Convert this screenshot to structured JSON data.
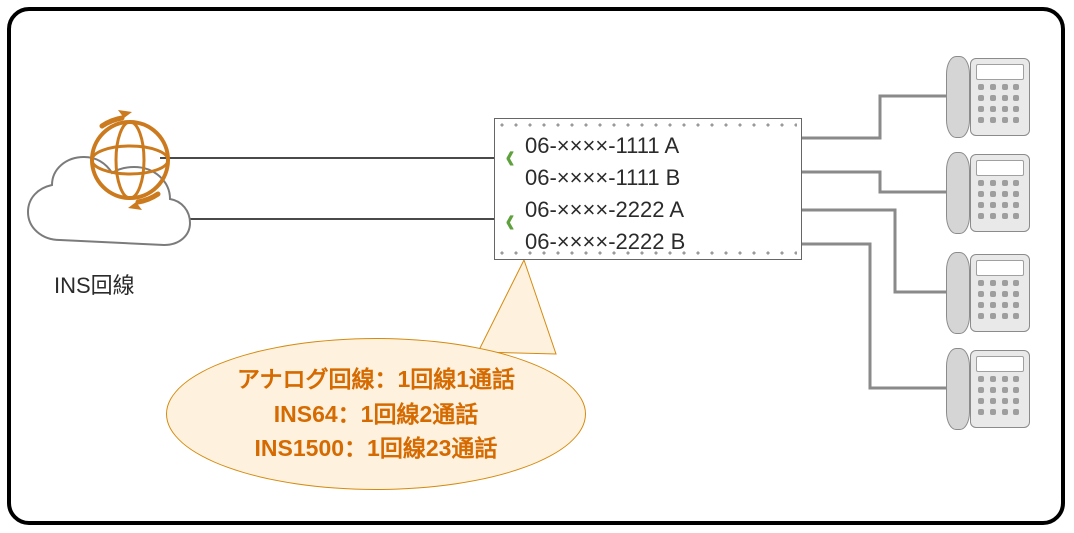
{
  "diagram_type": "network-telecom",
  "frame": {
    "radius": 22
  },
  "cloud": {
    "label": "INS回線"
  },
  "pbx": {
    "channels": [
      {
        "text": "06-××××-1111 A",
        "arrow": true
      },
      {
        "text": "06-××××-1111 B",
        "arrow": false
      },
      {
        "text": "06-××××-2222 A",
        "arrow": true
      },
      {
        "text": "06-××××-2222 B",
        "arrow": false
      }
    ]
  },
  "callout": {
    "lines": [
      "アナログ回線：1回線1通話",
      "INS64：1回線2通話",
      "INS1500：1回線23通話"
    ]
  },
  "phones": {
    "count": 4
  },
  "colors": {
    "accent_orange": "#d56a00",
    "callout_fill": "#fef2df",
    "callout_border": "#d68a0e",
    "arrow_green": "#5fa23d",
    "line_gray": "#8a8a8a",
    "globe_orange": "#cc7a1e"
  }
}
